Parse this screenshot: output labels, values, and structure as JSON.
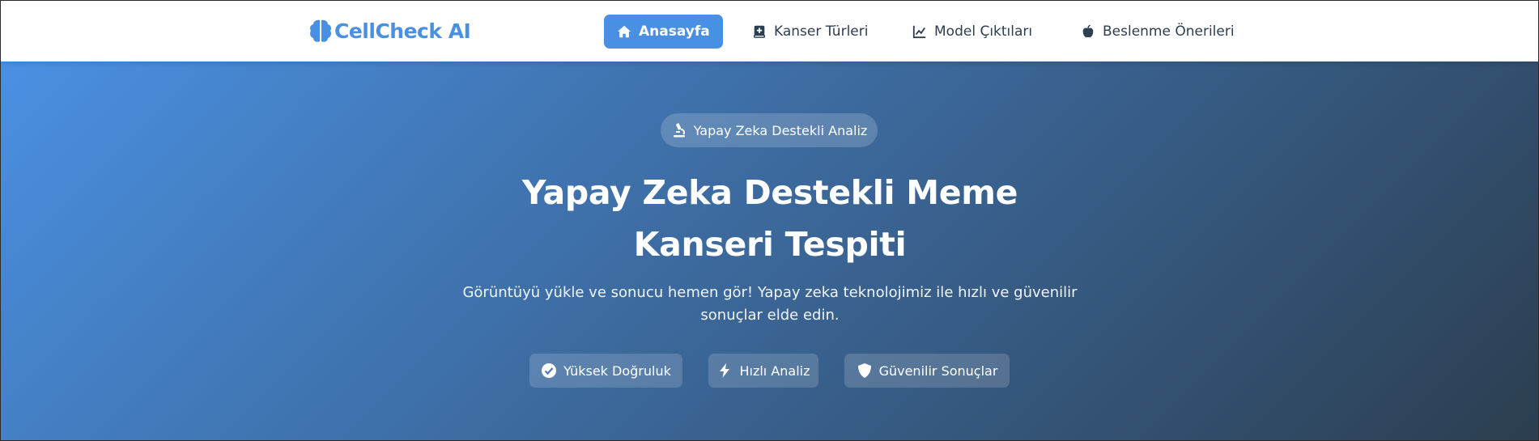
{
  "brand": {
    "name": "CellCheck AI",
    "icon": "brain-icon",
    "color": "#4a90e2"
  },
  "nav": {
    "items": [
      {
        "label": "Anasayfa",
        "icon": "home-icon",
        "active": true
      },
      {
        "label": "Kanser Türleri",
        "icon": "book-medical-icon",
        "active": false
      },
      {
        "label": "Model Çıktıları",
        "icon": "chart-line-icon",
        "active": false
      },
      {
        "label": "Beslenme Önerileri",
        "icon": "apple-icon",
        "active": false
      }
    ]
  },
  "hero": {
    "badge": {
      "label": "Yapay Zeka Destekli Analiz",
      "icon": "microscope-icon"
    },
    "title": "Yapay Zeka Destekli Meme Kanseri Tespiti",
    "subtitle": "Görüntüyü yükle ve sonucu hemen gör! Yapay zeka teknolojimiz ile hızlı ve güvenilir sonuçlar elde edin.",
    "features": [
      {
        "label": "Yüksek Doğruluk",
        "icon": "check-circle-icon"
      },
      {
        "label": "Hızlı Analiz",
        "icon": "bolt-icon"
      },
      {
        "label": "Güvenilir Sonuçlar",
        "icon": "shield-icon"
      }
    ]
  },
  "colors": {
    "accent": "#4a90e2",
    "dark": "#2c3e50",
    "text": "#2c3e50"
  }
}
